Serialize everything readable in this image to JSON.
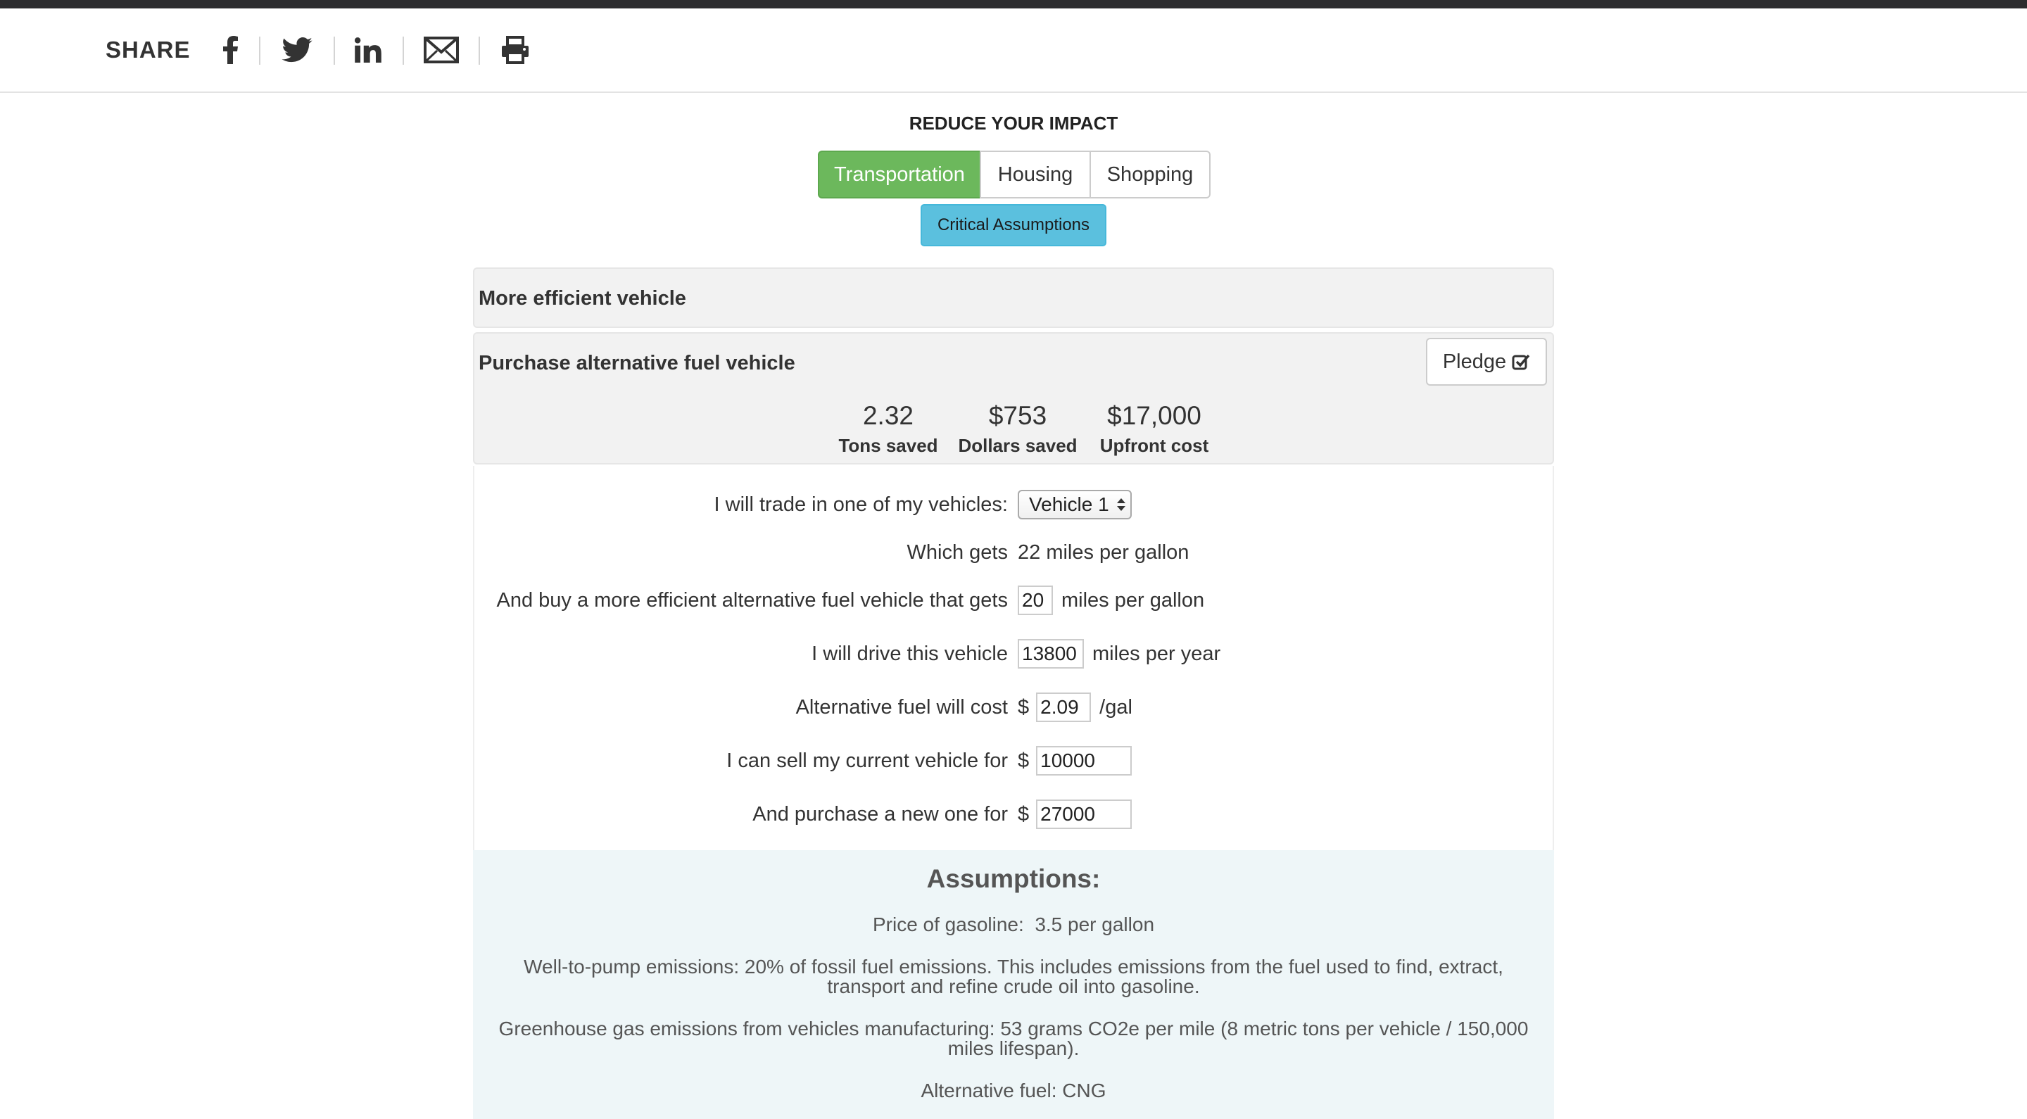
{
  "share": {
    "label": "SHARE",
    "icons": [
      "facebook-icon",
      "twitter-icon",
      "linkedin-icon",
      "email-icon",
      "print-icon"
    ]
  },
  "section_title": "REDUCE YOUR IMPACT",
  "tabs": [
    {
      "label": "Transportation",
      "active": true
    },
    {
      "label": "Housing",
      "active": false
    },
    {
      "label": "Shopping",
      "active": false
    }
  ],
  "critical_button": "Critical Assumptions",
  "panels": {
    "efficient": {
      "title": "More efficient vehicle"
    },
    "alt_fuel": {
      "title": "Purchase alternative fuel vehicle",
      "pledge": "Pledge",
      "stats": [
        {
          "value": "2.32",
          "label": "Tons saved"
        },
        {
          "value": "$753",
          "label": "Dollars saved"
        },
        {
          "value": "$17,000",
          "label": "Upfront cost"
        }
      ]
    }
  },
  "form": {
    "trade_in": {
      "label": "I will trade in one of my vehicles:",
      "value": "Vehicle 1"
    },
    "gets": {
      "label": "Which gets",
      "value": "22 miles per gallon"
    },
    "buy": {
      "label": "And buy a more efficient alternative fuel vehicle that gets",
      "value": "20",
      "unit": "miles per gallon"
    },
    "drive": {
      "label": "I will drive this vehicle",
      "value": "13800",
      "unit": "miles per year"
    },
    "fuel_cost": {
      "label": "Alternative fuel will cost",
      "prefix": "$",
      "value": "2.09",
      "unit": "/gal"
    },
    "sell": {
      "label": "I can sell my current vehicle for",
      "prefix": "$",
      "value": "10000"
    },
    "purchase": {
      "label": "And purchase a new one for",
      "prefix": "$",
      "value": "27000"
    }
  },
  "assumptions": {
    "title": "Assumptions:",
    "gas_label": "Price of gasoline:",
    "gas_value": "3.5 per gallon",
    "well_to_pump": "Well-to-pump emissions: 20% of fossil fuel emissions. This includes emissions from the fuel used to find, extract, transport and refine crude oil into gasoline.",
    "manufacturing": "Greenhouse gas emissions from vehicles manufacturing: 53 grams CO2e per mile (8 metric tons per vehicle / 150,000 miles lifespan).",
    "alt_fuel": "Alternative fuel: CNG"
  },
  "colors": {
    "active_tab": "#6cb85c",
    "info_button": "#5bc0de",
    "assumptions_bg": "#eef6f8"
  }
}
